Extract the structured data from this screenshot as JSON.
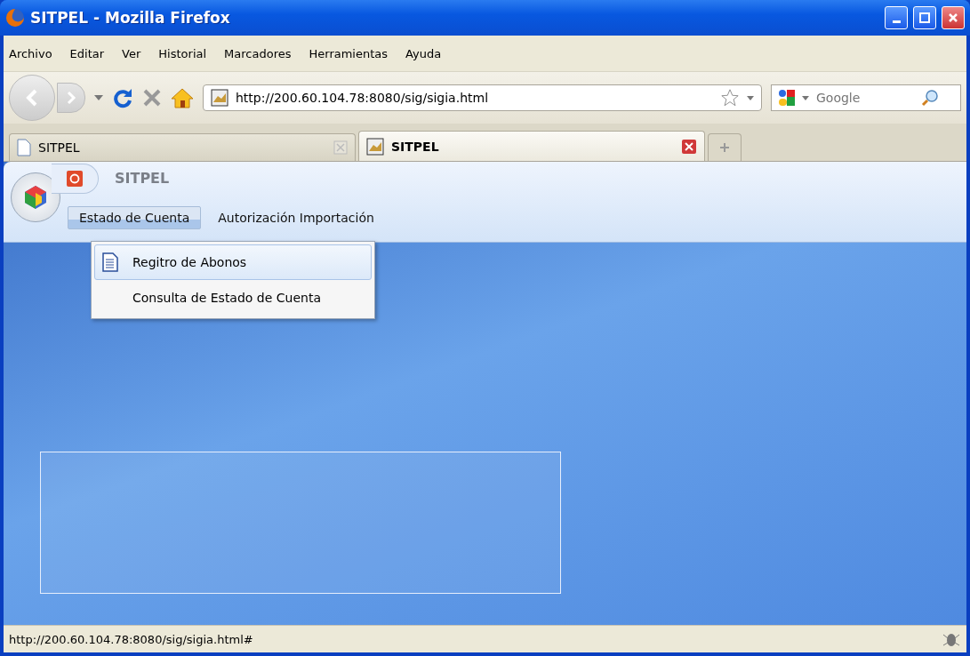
{
  "window": {
    "title": "SITPEL - Mozilla Firefox"
  },
  "menu_bar": [
    "Archivo",
    "Editar",
    "Ver",
    "Historial",
    "Marcadores",
    "Herramientas",
    "Ayuda"
  ],
  "address_bar": {
    "value": "http://200.60.104.78:8080/sig/sigia.html"
  },
  "search": {
    "placeholder": "Google"
  },
  "tabs": [
    {
      "label": "SITPEL",
      "selected": false
    },
    {
      "label": "SITPEL",
      "selected": true
    }
  ],
  "app": {
    "title": "SITPEL",
    "menu": [
      {
        "label": "Estado de Cuenta",
        "selected": true
      },
      {
        "label": "Autorización Importación",
        "selected": false
      }
    ],
    "dropdown": [
      {
        "label": "Regitro de Abonos",
        "selected": true,
        "kind": "document"
      },
      {
        "label": "Consulta de Estado de Cuenta",
        "selected": false,
        "kind": "plain"
      }
    ]
  },
  "status_bar": {
    "text": "http://200.60.104.78:8080/sig/sigia.html#"
  }
}
